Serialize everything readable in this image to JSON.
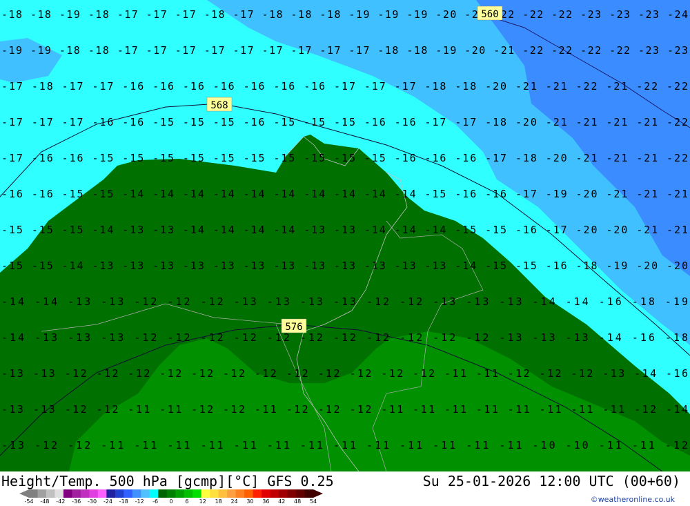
{
  "footer": {
    "title": "Height/Temp. 500 hPa [gcmp][°C] GFS 0.25",
    "datetime": "Su 25-01-2026 12:00 UTC (00+60)",
    "credit": "©weatheronline.co.uk"
  },
  "legend": {
    "ticks": [
      "-54",
      "-48",
      "-42",
      "-36",
      "-30",
      "-24",
      "-18",
      "-12",
      "-6",
      "0",
      "6",
      "12",
      "18",
      "24",
      "30",
      "36",
      "42",
      "48",
      "54"
    ],
    "colors": [
      "#808080",
      "#a0a0a0",
      "#c0c0c0",
      "#e0e0e0",
      "#800080",
      "#a020a0",
      "#c030c0",
      "#e040e0",
      "#ff60ff",
      "#2020a0",
      "#2040d0",
      "#3060ff",
      "#4090ff",
      "#50c0ff",
      "#00ffff",
      "#006400",
      "#008000",
      "#00a000",
      "#00c000",
      "#00e000",
      "#ffff40",
      "#ffe040",
      "#ffc040",
      "#ffa040",
      "#ff8020",
      "#ff6000",
      "#ff2000",
      "#e00000",
      "#c00000",
      "#a00000",
      "#800000",
      "#600000",
      "#400000"
    ]
  },
  "map": {
    "colors": {
      "band_blue": "#3a8cff",
      "band_lightblue": "#40c0ff",
      "band_cyan": "#30ffff",
      "band_darkgreen": "#007000",
      "band_green": "#009000"
    },
    "height_contours": [
      "560",
      "568",
      "576"
    ],
    "temperature_rows": [
      "-18 -18 -19 -18 -17 -17 -17 -18 -17 -18 -18 -18 -19 -19 -19 -20 -21 -22 -22 -22 -23 -23 -23 -24",
      "-19 -19 -18 -18 -17 -17 -17 -17 -17 -17 -17 -17 -17 -18 -18 -19 -20 -21 -22 -22 -22 -22 -23 -23",
      "-17 -18 -17 -17 -16 -16 -16 -16 -16 -16 -16 -17 -17 -17 -18 -18 -20 -21 -21 -22 -21 -22 -22",
      "-17 -17 -17 -16 -16 -15 -15 -15 -16 -15 -15 -15 -16 -16 -17 -17 -18 -20 -21 -21 -21 -21 -22",
      "-17 -16 -16 -15 -15 -15 -15 -15 -15 -15 -15 -15 -15 -16 -16 -16 -17 -18 -20 -21 -21 -21 -22",
      "-16 -16 -15 -15 -14 -14 -14 -14 -14 -14 -14 -14 -14 -14 -15 -16 -16 -17 -19 -20 -21 -21 -21",
      "-15 -15 -15 -14 -13 -13 -14 -14 -14 -14 -13 -13 -14 -14 -14 -15 -15 -16 -17 -20 -20 -21 -21",
      "-15 -15 -14 -13 -13 -13 -13 -13 -13 -13 -13 -13 -13 -13 -13 -14 -15 -15 -16 -18 -19 -20 -20",
      "-14 -14 -13 -13 -12 -12 -12 -13 -13 -13 -13 -12 -12 -13 -13 -13 -14 -14 -16 -18 -19",
      "-14 -13 -13 -13 -12 -12 -12 -12 -12 -12 -12 -12 -12 -12 -12 -13 -13 -13 -14 -16 -18",
      "-13 -13 -12 -12 -12 -12 -12 -12 -12 -12 -12 -12 -12 -12 -11 -11 -12 -12 -12 -13 -14 -16",
      "-13 -13 -12 -12 -11 -11 -12 -12 -11 -12 -12 -12 -11 -11 -11 -11 -11 -11 -11 -11 -12 -14",
      "-13 -12 -12 -11 -11 -11 -11 -11 -11 -11 -11 -11 -11 -11 -11 -11 -10 -10 -11 -11 -12"
    ]
  }
}
